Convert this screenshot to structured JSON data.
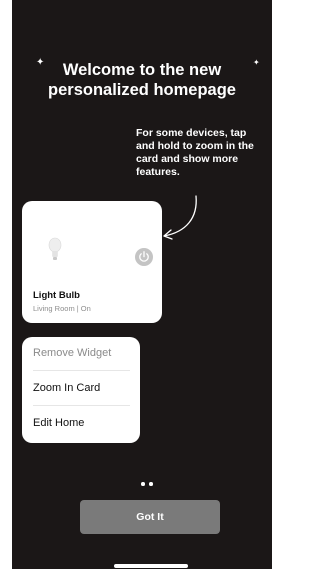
{
  "onboarding": {
    "title_line1": "Welcome to the new",
    "title_line2": "personalized homepage",
    "hint_line1": "For some devices, tap",
    "hint_line2": "and hold to zoom in the",
    "hint_line3": "card and show more",
    "hint_line4": "features."
  },
  "device_card": {
    "name": "Light Bulb",
    "status": "Living Room | On",
    "icon": "light-bulb-icon",
    "power_icon": "power-icon"
  },
  "context_menu": {
    "items": [
      {
        "label": "Remove Widget"
      },
      {
        "label": "Zoom In Card"
      },
      {
        "label": "Edit Home"
      }
    ]
  },
  "pagination": {
    "total": 2
  },
  "actions": {
    "got_it_label": "Got It"
  },
  "colors": {
    "background": "#1b1717",
    "card": "#ffffff",
    "button": "#7a7a7a",
    "text_primary": "#ffffff",
    "muted": "#8e8e8e"
  }
}
